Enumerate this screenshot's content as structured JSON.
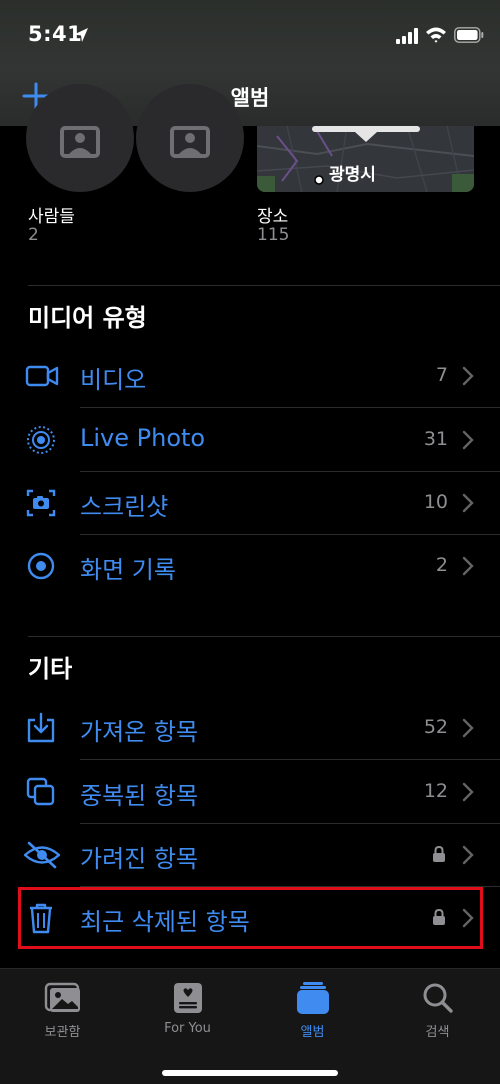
{
  "status_bar": {
    "time": "5:41"
  },
  "header": {
    "title": "앨범"
  },
  "top_albums": [
    {
      "label": "사람들",
      "count": "2"
    },
    {
      "label": "장소",
      "count": "115",
      "map_label": "광명시"
    }
  ],
  "media_types": {
    "title": "미디어 유형",
    "items": [
      {
        "label": "비디오",
        "count": "7",
        "icon": "video-icon"
      },
      {
        "label": "Live Photo",
        "count": "31",
        "icon": "live-photo-icon"
      },
      {
        "label": "스크린샷",
        "count": "10",
        "icon": "screenshot-icon"
      },
      {
        "label": "화면 기록",
        "count": "2",
        "icon": "screen-recording-icon"
      }
    ]
  },
  "other": {
    "title": "기타",
    "items": [
      {
        "label": "가져온 항목",
        "count": "52",
        "icon": "import-icon"
      },
      {
        "label": "중복된 항목",
        "count": "12",
        "icon": "duplicates-icon"
      },
      {
        "label": "가려진 항목",
        "locked": true,
        "icon": "hidden-eye-icon"
      },
      {
        "label": "최근 삭제된 항목",
        "locked": true,
        "icon": "trash-icon"
      }
    ]
  },
  "tab_bar": {
    "tabs": [
      {
        "label": "보관함",
        "active": false
      },
      {
        "label": "For You",
        "active": false
      },
      {
        "label": "앨범",
        "active": true
      },
      {
        "label": "검색",
        "active": false
      }
    ]
  },
  "colors": {
    "accent": "#3f8bf0",
    "highlight": "#e00d1b",
    "secondary_text": "#8e8e93"
  }
}
